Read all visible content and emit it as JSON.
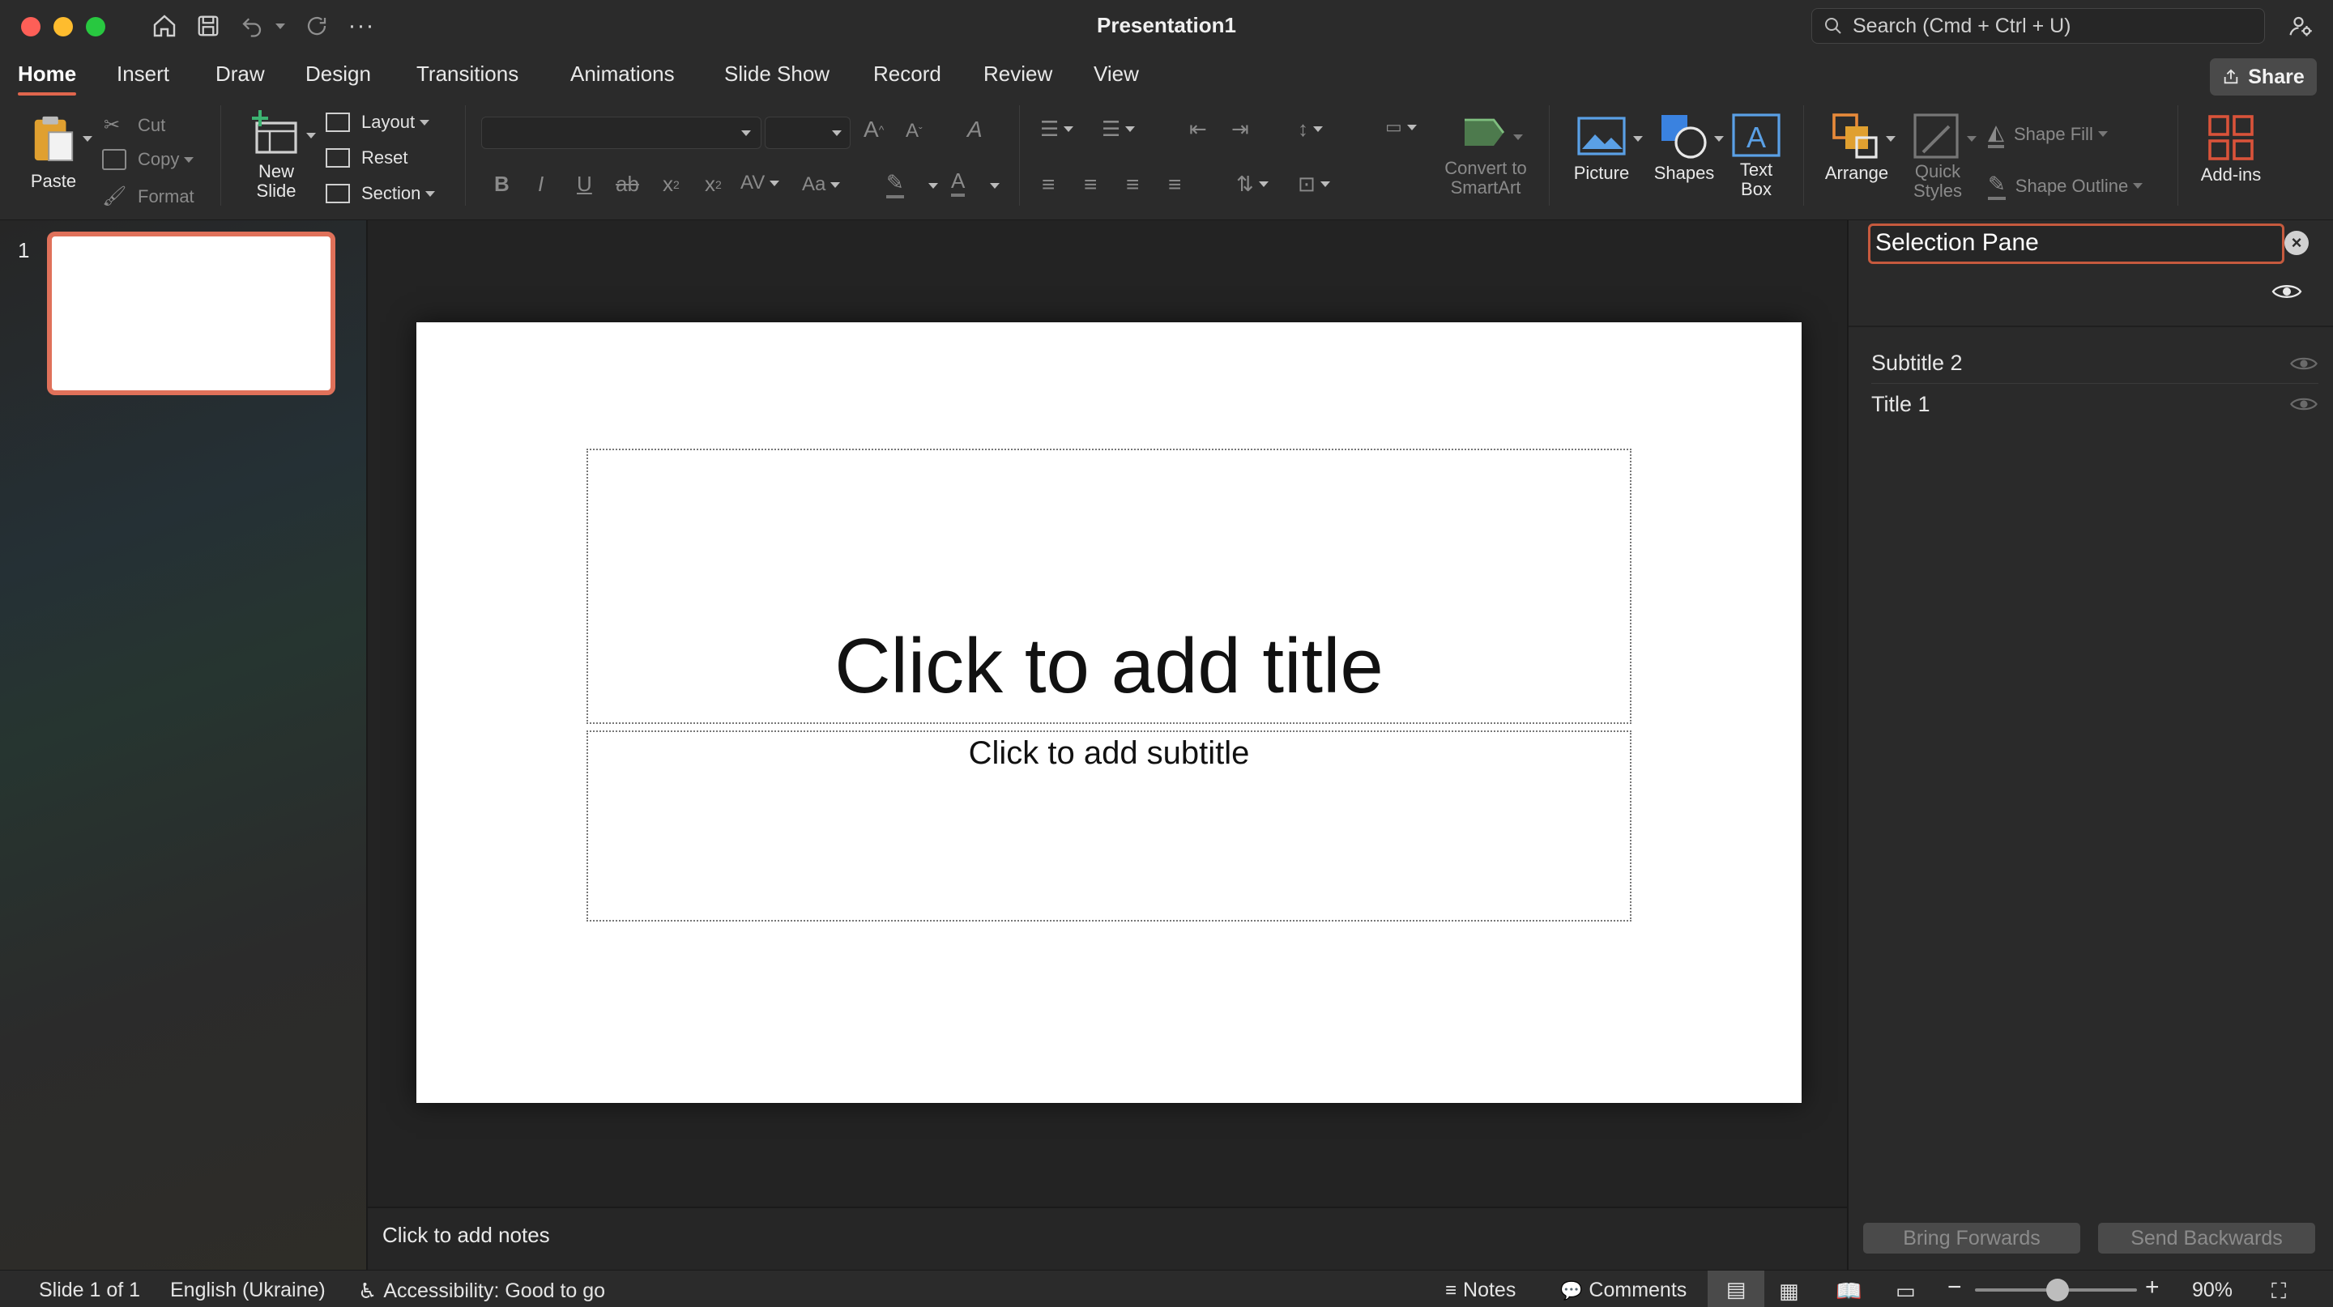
{
  "window": {
    "title": "Presentation1",
    "search_placeholder": "Search (Cmd + Ctrl + U)"
  },
  "tabs": [
    {
      "label": "Home",
      "active": true
    },
    {
      "label": "Insert"
    },
    {
      "label": "Draw"
    },
    {
      "label": "Design"
    },
    {
      "label": "Transitions"
    },
    {
      "label": "Animations"
    },
    {
      "label": "Slide Show"
    },
    {
      "label": "Record"
    },
    {
      "label": "Review"
    },
    {
      "label": "View"
    }
  ],
  "share_label": "Share",
  "ribbon": {
    "paste": "Paste",
    "cut": "Cut",
    "copy": "Copy",
    "format": "Format",
    "new_slide": "New Slide",
    "layout": "Layout",
    "reset": "Reset",
    "section": "Section",
    "convert_smartart": "Convert to SmartArt",
    "picture": "Picture",
    "shapes": "Shapes",
    "text_box": "Text Box",
    "arrange": "Arrange",
    "quick_styles": "Quick Styles",
    "shape_fill": "Shape Fill",
    "shape_outline": "Shape Outline",
    "add_ins": "Add-ins"
  },
  "slides": [
    {
      "number": "1"
    }
  ],
  "slide": {
    "title_placeholder": "Click to add title",
    "subtitle_placeholder": "Click to add subtitle"
  },
  "notes_placeholder": "Click to add notes",
  "selection_pane": {
    "title": "Selection Pane",
    "items": [
      {
        "label": "Subtitle 2"
      },
      {
        "label": "Title 1"
      }
    ],
    "bring_forwards": "Bring Forwards",
    "send_backwards": "Send Backwards"
  },
  "status": {
    "slide_info": "Slide 1 of 1",
    "language": "English (Ukraine)",
    "accessibility": "Accessibility: Good to go",
    "notes": "Notes",
    "comments": "Comments",
    "zoom": "90%"
  },
  "colors": {
    "accent": "#e0664d",
    "selection_border": "#c65a3e"
  }
}
